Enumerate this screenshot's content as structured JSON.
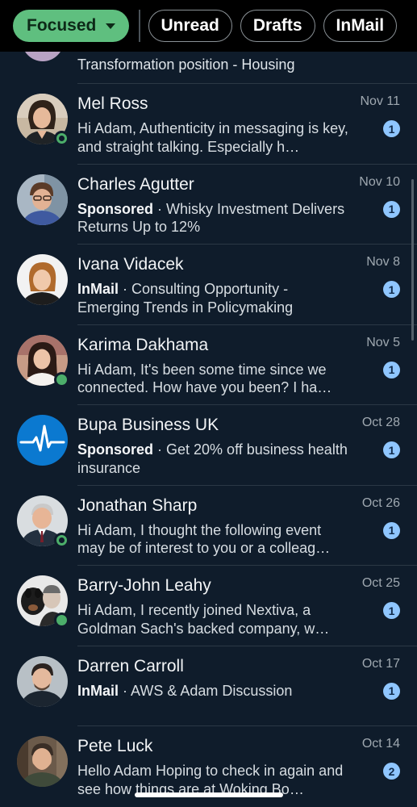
{
  "tabs": {
    "focused": "Focused",
    "unread": "Unread",
    "drafts": "Drafts",
    "inmail": "InMail"
  },
  "partial_row": {
    "snippet": "Transformation position - Housing"
  },
  "conversations": [
    {
      "name": "Mel Ross",
      "date": "Nov 11",
      "tag": "",
      "snippet": "Hi Adam,  Authenticity in messaging is key, and straight talking. Especially h…",
      "unread": "1"
    },
    {
      "name": "Charles Agutter",
      "date": "Nov 10",
      "tag": "Sponsored",
      "snippet": " · Whisky Investment Delivers Returns Up to 12%",
      "unread": "1"
    },
    {
      "name": "Ivana Vidacek",
      "date": "Nov 8",
      "tag": "InMail",
      "snippet": " · Consulting Opportunity - Emerging Trends in Policymaking",
      "unread": "1"
    },
    {
      "name": "Karima Dakhama",
      "date": "Nov 5",
      "tag": "",
      "snippet": "Hi Adam, It's been some time since we connected. How have you been? I ha…",
      "unread": "1"
    },
    {
      "name": "Bupa Business UK",
      "date": "Oct 28",
      "tag": "Sponsored",
      "snippet": " · Get 20% off business health insurance",
      "unread": "1"
    },
    {
      "name": "Jonathan Sharp",
      "date": "Oct 26",
      "tag": "",
      "snippet": "Hi Adam, I thought the following event may be of interest to you or a colleag…",
      "unread": "1"
    },
    {
      "name": "Barry-John Leahy",
      "date": "Oct 25",
      "tag": "",
      "snippet": "Hi Adam, I recently joined Nextiva, a Goldman Sach's backed company, w…",
      "unread": "1"
    },
    {
      "name": "Darren Carroll",
      "date": "Oct 17",
      "tag": "InMail",
      "snippet": " · AWS & Adam Discussion",
      "unread": "1"
    },
    {
      "name": "Pete Luck",
      "date": "Oct 14",
      "tag": "",
      "snippet": "Hello Adam Hoping to check in again and see how things are at Woking Bo…",
      "unread": "2"
    }
  ],
  "colors": {
    "background": "#0f1c2b",
    "focused_pill": "#5fbf7f",
    "unread_badge": "#8fc6ff",
    "presence": "#4cae6a",
    "bupa_blue": "#0b79d0"
  }
}
